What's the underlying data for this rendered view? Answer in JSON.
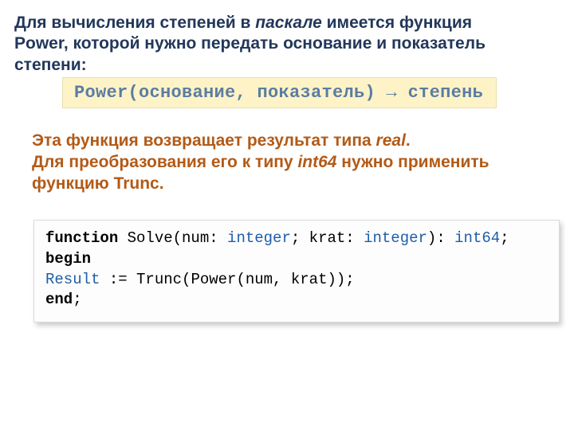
{
  "intro": {
    "t1": "Для вычисления степеней в ",
    "pascal": "паскале",
    "t2": " имеется функция ",
    "power": "Power,",
    "t3": " которой нужно передать основание и показатель степени:"
  },
  "power_box": "Power(основание, показатель) → степень",
  "para2": {
    "l1a": "Эта функция возвращает результат типа ",
    "real": "real",
    "l1b": ".",
    "l2a": "Для преобразования его к типу ",
    "int64": "int64",
    "l2b": " нужно применить функцию ",
    "trunc": "Trunc",
    "l2c": "."
  },
  "code": {
    "kw_function": "function",
    "solve": " Solve(num: ",
    "t_int1": "integer",
    "semi1": "; krat: ",
    "t_int2": "integer",
    "ret": "): ",
    "t_int64": "int64",
    "eol1": ";",
    "kw_begin": "begin",
    "result": "Result",
    "assign": " := Trunc(Power(num, krat));",
    "kw_end": "end",
    "eol4": ";"
  }
}
